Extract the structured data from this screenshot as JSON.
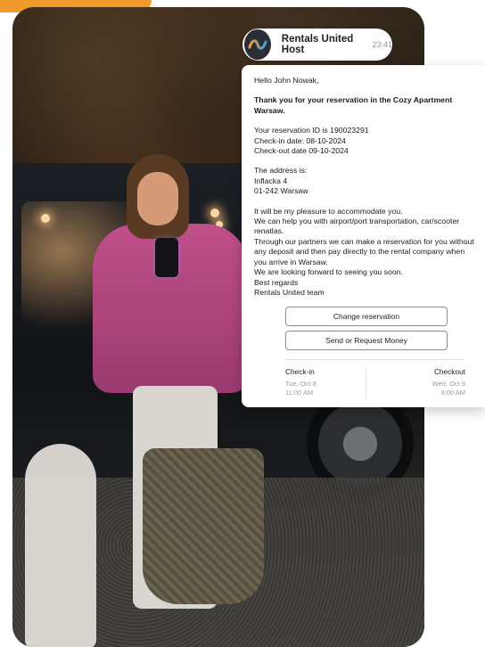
{
  "brand": {
    "accent_color": "#f29a2e",
    "logo_icon": "rentals-united-wave-icon"
  },
  "header": {
    "sender_name": "Rentals United Host",
    "time": "23:41"
  },
  "message": {
    "greeting": "Hello John Nowak,",
    "thanks": "Thank you for your reservation in the Cozy Apartment Warsaw.",
    "reservation_id": "Your reservation ID is 190023291",
    "checkin_line": "Check-in date: 08-10-2024",
    "checkout_line": "Check-out date 09-10-2024",
    "address_label": "The address is:",
    "address_street": "Inflacka 4",
    "address_city": "01-242 Warsaw",
    "line1": "It will be my pleasure to accommodate you.",
    "line2": "We can help you with airport/port transportation, car/scooter renatlas.",
    "line3": "Through our partners we can make a reservation for you without any deposit and then pay directly to the rental company when you arrive in Warsaw.",
    "line4": "We are looking forward to seeing you soon.",
    "line5": "Best regards",
    "line6": "Rentals United team"
  },
  "actions": {
    "change_label": "Change reservation",
    "money_label": "Send or Request Money"
  },
  "dates": {
    "checkin": {
      "label": "Check-in",
      "day": "Tue, Oct 8",
      "time": "11:00 AM"
    },
    "checkout": {
      "label": "Checkout",
      "day": "Wed, Oct 9",
      "time": "9:00 AM"
    }
  }
}
